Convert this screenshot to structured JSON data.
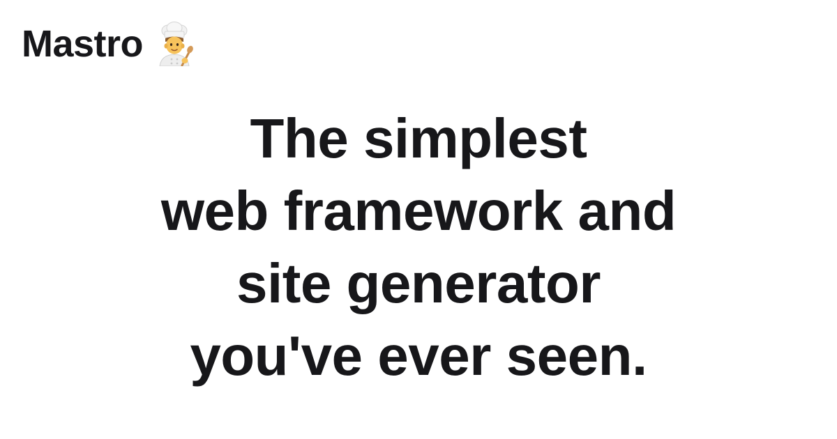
{
  "brand": {
    "name": "Mastro",
    "icon": "chef-emoji"
  },
  "headline": {
    "lines": [
      "The simplest",
      "web framework and",
      "site generator",
      "you've ever seen."
    ]
  },
  "colors": {
    "background": "#ffffff",
    "text": "#17171a"
  }
}
